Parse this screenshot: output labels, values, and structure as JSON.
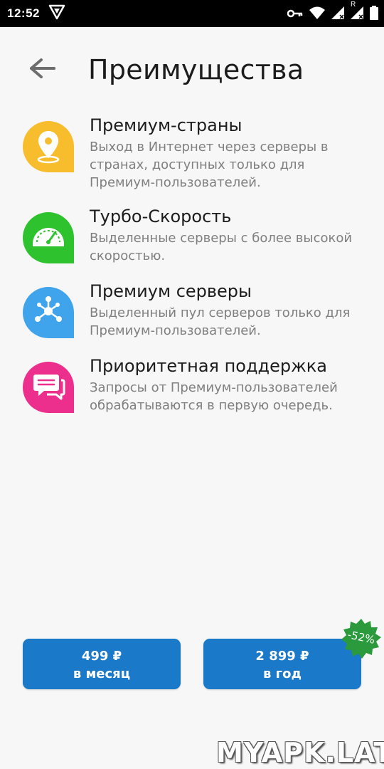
{
  "status_bar": {
    "time": "12:52",
    "icons": [
      "vpn-logo-icon",
      "key-icon",
      "wifi-icon",
      "signal-icon",
      "signal-roaming-icon",
      "battery-icon"
    ],
    "roaming_label": "R"
  },
  "app_bar": {
    "back_icon": "arrow-left-icon",
    "title": "Преимущества"
  },
  "features": [
    {
      "icon": "location-pin-icon",
      "color": "#f8bd2c",
      "title": "Премиум-страны",
      "description": "Выход в Интернет через серверы в странах, доступных только для Премиум-пользователей."
    },
    {
      "icon": "speedometer-icon",
      "color": "#2ec22e",
      "title": "Турбо-Скорость",
      "description": "Выделенные серверы с более высокой скоростью."
    },
    {
      "icon": "network-nodes-icon",
      "color": "#40a4ec",
      "title": "Премиум серверы",
      "description": "Выделенный пул серверов только для Премиум-пользователей."
    },
    {
      "icon": "chat-bubble-icon",
      "color": "#ec2f8c",
      "title": "Приоритетная поддержка",
      "description": "Запросы от Премиум-пользователей обрабатываются в первую очередь."
    }
  ],
  "plans": [
    {
      "price": "499 ₽",
      "period": "в месяц"
    },
    {
      "price": "2 899 ₽",
      "period": "в год"
    }
  ],
  "discount_badge": "-52%",
  "colors": {
    "accent": "#1a79c8",
    "badge": "#2a9a3c",
    "background": "#f7f7f7"
  },
  "watermark": "MYAPK.LAT"
}
